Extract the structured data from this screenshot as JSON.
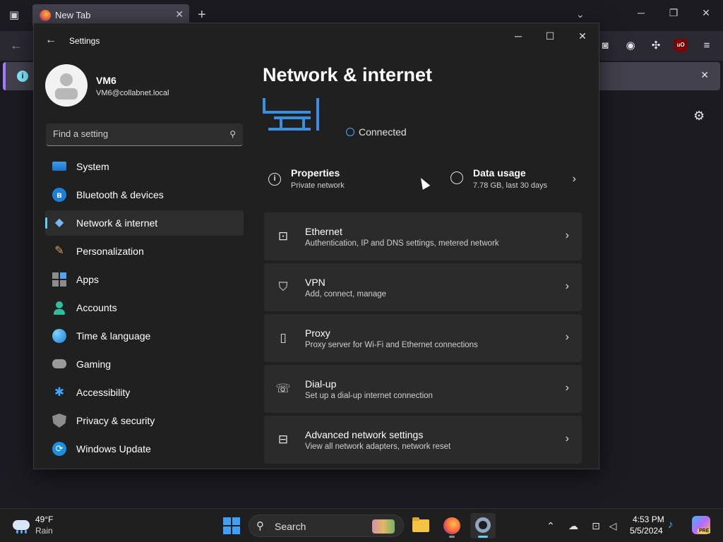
{
  "firefox": {
    "tab_title": "New Tab",
    "ublock_label": "uO"
  },
  "settings": {
    "window_title": "Settings",
    "user": {
      "name": "VM6",
      "email": "VM6@collabnet.local"
    },
    "search_placeholder": "Find a setting",
    "nav": [
      {
        "label": "System",
        "icon": "monitor-icon"
      },
      {
        "label": "Bluetooth & devices",
        "icon": "bluetooth-icon"
      },
      {
        "label": "Network & internet",
        "icon": "wifi-icon",
        "active": true
      },
      {
        "label": "Personalization",
        "icon": "paintbrush-icon"
      },
      {
        "label": "Apps",
        "icon": "apps-icon"
      },
      {
        "label": "Accounts",
        "icon": "person-icon"
      },
      {
        "label": "Time & language",
        "icon": "globe-clock-icon"
      },
      {
        "label": "Gaming",
        "icon": "gamepad-icon"
      },
      {
        "label": "Accessibility",
        "icon": "accessibility-icon"
      },
      {
        "label": "Privacy & security",
        "icon": "shield-icon"
      },
      {
        "label": "Windows Update",
        "icon": "update-icon"
      }
    ],
    "page_title": "Network & internet",
    "status": "Connected",
    "properties": {
      "title": "Properties",
      "subtitle": "Private network"
    },
    "data_usage": {
      "title": "Data usage",
      "subtitle": "7.78 GB, last 30 days"
    },
    "cards": [
      {
        "title": "Ethernet",
        "subtitle": "Authentication, IP and DNS settings, metered network",
        "icon": "ethernet-icon"
      },
      {
        "title": "VPN",
        "subtitle": "Add, connect, manage",
        "icon": "vpn-shield-icon"
      },
      {
        "title": "Proxy",
        "subtitle": "Proxy server for Wi-Fi and Ethernet connections",
        "icon": "proxy-icon"
      },
      {
        "title": "Dial-up",
        "subtitle": "Set up a dial-up internet connection",
        "icon": "phone-icon"
      },
      {
        "title": "Advanced network settings",
        "subtitle": "View all network adapters, network reset",
        "icon": "network-monitor-icon"
      }
    ]
  },
  "taskbar": {
    "weather": {
      "temp": "49°F",
      "desc": "Rain"
    },
    "search_label": "Search",
    "clock": {
      "time": "4:53 PM",
      "date": "5/5/2024"
    },
    "copilot_badge": "PRE"
  },
  "colors": {
    "accent": "#60cdff",
    "window_bg": "#202020",
    "card_bg": "#2b2b2b",
    "router_blue": "#3a8fe0"
  }
}
